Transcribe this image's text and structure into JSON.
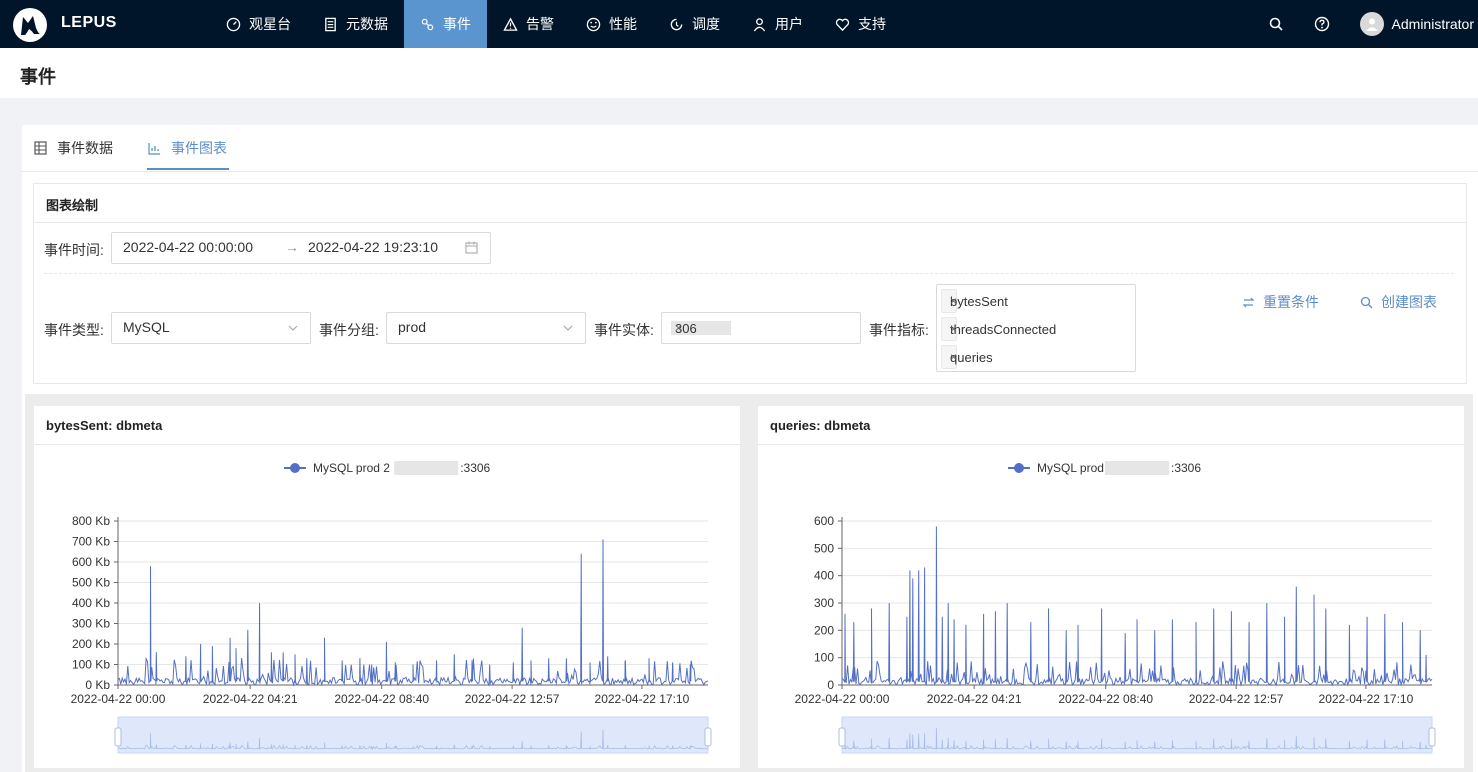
{
  "app": {
    "brand": "LEPUS"
  },
  "nav": [
    {
      "label": "观星台",
      "icon": "dashboard-icon"
    },
    {
      "label": "元数据",
      "icon": "database-icon"
    },
    {
      "label": "事件",
      "icon": "event-icon",
      "active": true
    },
    {
      "label": "告警",
      "icon": "alert-icon"
    },
    {
      "label": "性能",
      "icon": "performance-icon"
    },
    {
      "label": "调度",
      "icon": "schedule-icon"
    },
    {
      "label": "用户",
      "icon": "user-icon"
    },
    {
      "label": "支持",
      "icon": "heart-icon"
    }
  ],
  "user": {
    "name": "Administrator"
  },
  "page": {
    "title": "事件"
  },
  "tabs": [
    {
      "label": "事件数据",
      "icon": "table-icon"
    },
    {
      "label": "事件图表",
      "icon": "bar-chart-icon",
      "active": true
    }
  ],
  "form": {
    "section_title": "图表绘制",
    "time_label": "事件时间:",
    "time_start": "2022-04-22 00:00:00",
    "time_arrow": "→",
    "time_end": "2022-04-22 19:23:10",
    "type_label": "事件类型:",
    "type_value": "MySQL",
    "group_label": "事件分组:",
    "group_value": "prod",
    "entity_label": "事件实体:",
    "entity_value_prefix": "21",
    "entity_value_suffix": "306",
    "metric_label": "事件指标:",
    "metric_tags": [
      "bytesSent",
      "threadsConnected",
      "queries"
    ],
    "reset_label": "重置条件",
    "create_label": "创建图表"
  },
  "chart_data": [
    {
      "type": "line",
      "title": "bytesSent: dbmeta",
      "legend": {
        "label_prefix": "MySQL prod 2",
        "label_suffix": ":3306",
        "position": "top-center"
      },
      "color": "#5470c6",
      "ylim": [
        0,
        800
      ],
      "ytick_labels": [
        "0 Kb",
        "100 Kb",
        "200 Kb",
        "300 Kb",
        "400 Kb",
        "500 Kb",
        "600 Kb",
        "700 Kb",
        "800 Kb"
      ],
      "yticks": [
        0,
        100,
        200,
        300,
        400,
        500,
        600,
        700,
        800
      ],
      "xtick_labels": [
        "2022-04-22 00:00",
        "2022-04-22 04:21",
        "2022-04-22 08:40",
        "2022-04-22 12:57",
        "2022-04-22 17:10"
      ],
      "grid": true,
      "spikes": [
        {
          "x": 0.055,
          "y": 580
        },
        {
          "x": 0.065,
          "y": 160
        },
        {
          "x": 0.115,
          "y": 140
        },
        {
          "x": 0.14,
          "y": 200
        },
        {
          "x": 0.16,
          "y": 190
        },
        {
          "x": 0.2,
          "y": 180
        },
        {
          "x": 0.22,
          "y": 270
        },
        {
          "x": 0.26,
          "y": 160
        },
        {
          "x": 0.28,
          "y": 160
        },
        {
          "x": 0.3,
          "y": 150
        },
        {
          "x": 0.32,
          "y": 130
        },
        {
          "x": 0.35,
          "y": 120
        },
        {
          "x": 0.38,
          "y": 120
        },
        {
          "x": 0.41,
          "y": 130
        },
        {
          "x": 0.43,
          "y": 100
        },
        {
          "x": 0.47,
          "y": 110
        },
        {
          "x": 0.5,
          "y": 100
        },
        {
          "x": 0.54,
          "y": 120
        },
        {
          "x": 0.57,
          "y": 150
        },
        {
          "x": 0.6,
          "y": 120
        },
        {
          "x": 0.63,
          "y": 100
        },
        {
          "x": 0.67,
          "y": 110
        },
        {
          "x": 0.7,
          "y": 120
        },
        {
          "x": 0.73,
          "y": 130
        },
        {
          "x": 0.76,
          "y": 130
        },
        {
          "x": 0.8,
          "y": 110
        },
        {
          "x": 0.83,
          "y": 140
        },
        {
          "x": 0.86,
          "y": 120
        },
        {
          "x": 0.9,
          "y": 130
        },
        {
          "x": 0.94,
          "y": 110
        },
        {
          "x": 0.97,
          "y": 100
        },
        {
          "x": 0.19,
          "y": 230
        },
        {
          "x": 0.24,
          "y": 400
        },
        {
          "x": 0.35,
          "y": 230
        },
        {
          "x": 0.455,
          "y": 210
        },
        {
          "x": 0.685,
          "y": 280
        },
        {
          "x": 0.785,
          "y": 640
        },
        {
          "x": 0.822,
          "y": 710
        }
      ],
      "baseline": 60
    },
    {
      "type": "line",
      "title": "queries: dbmeta",
      "legend": {
        "label_prefix": "MySQL prod",
        "label_suffix": ":3306",
        "position": "top-center"
      },
      "color": "#5470c6",
      "ylim": [
        0,
        600
      ],
      "ytick_labels": [
        "0",
        "100",
        "200",
        "300",
        "400",
        "500",
        "600"
      ],
      "yticks": [
        0,
        100,
        200,
        300,
        400,
        500,
        600
      ],
      "xtick_labels": [
        "2022-04-22 00:00",
        "2022-04-22 04:21",
        "2022-04-22 08:40",
        "2022-04-22 12:57",
        "2022-04-22 17:10"
      ],
      "grid": true,
      "spikes": [
        {
          "x": 0.005,
          "y": 260
        },
        {
          "x": 0.02,
          "y": 230
        },
        {
          "x": 0.05,
          "y": 280
        },
        {
          "x": 0.08,
          "y": 300
        },
        {
          "x": 0.11,
          "y": 250
        },
        {
          "x": 0.115,
          "y": 420
        },
        {
          "x": 0.12,
          "y": 390
        },
        {
          "x": 0.13,
          "y": 420
        },
        {
          "x": 0.14,
          "y": 430
        },
        {
          "x": 0.16,
          "y": 580
        },
        {
          "x": 0.17,
          "y": 250
        },
        {
          "x": 0.18,
          "y": 300
        },
        {
          "x": 0.19,
          "y": 240
        },
        {
          "x": 0.21,
          "y": 220
        },
        {
          "x": 0.24,
          "y": 260
        },
        {
          "x": 0.26,
          "y": 270
        },
        {
          "x": 0.28,
          "y": 300
        },
        {
          "x": 0.32,
          "y": 230
        },
        {
          "x": 0.35,
          "y": 280
        },
        {
          "x": 0.38,
          "y": 200
        },
        {
          "x": 0.4,
          "y": 220
        },
        {
          "x": 0.44,
          "y": 280
        },
        {
          "x": 0.48,
          "y": 190
        },
        {
          "x": 0.5,
          "y": 240
        },
        {
          "x": 0.53,
          "y": 200
        },
        {
          "x": 0.56,
          "y": 240
        },
        {
          "x": 0.6,
          "y": 230
        },
        {
          "x": 0.63,
          "y": 280
        },
        {
          "x": 0.66,
          "y": 270
        },
        {
          "x": 0.69,
          "y": 230
        },
        {
          "x": 0.72,
          "y": 300
        },
        {
          "x": 0.75,
          "y": 250
        },
        {
          "x": 0.77,
          "y": 360
        },
        {
          "x": 0.8,
          "y": 330
        },
        {
          "x": 0.82,
          "y": 280
        },
        {
          "x": 0.86,
          "y": 220
        },
        {
          "x": 0.89,
          "y": 250
        },
        {
          "x": 0.92,
          "y": 260
        },
        {
          "x": 0.95,
          "y": 230
        },
        {
          "x": 0.98,
          "y": 200
        },
        {
          "x": 0.99,
          "y": 110
        }
      ],
      "baseline": 40
    }
  ]
}
